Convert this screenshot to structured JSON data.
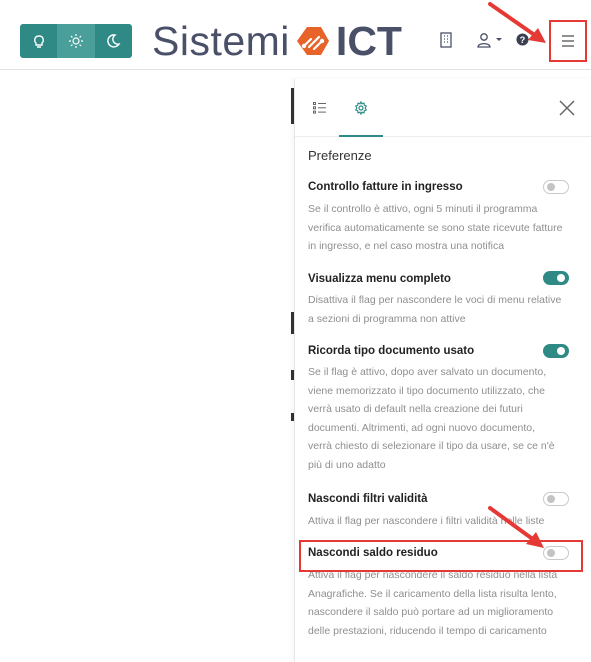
{
  "theme": {
    "options": [
      {
        "name": "light",
        "icon": "lightbulb-icon"
      },
      {
        "name": "auto",
        "icon": "sun-icon"
      },
      {
        "name": "dark",
        "icon": "moon-icon"
      }
    ],
    "active": "auto",
    "accent": "#2f8a86"
  },
  "logo": {
    "part1": "Sistemi",
    "part2": "ICT",
    "mark_color": "#e8632a"
  },
  "toolbar": {
    "icons": [
      "building-icon",
      "user-icon",
      "help-icon",
      "hamburger-menu-icon"
    ]
  },
  "panel": {
    "tabs": [
      {
        "name": "list",
        "icon": "list-icon"
      },
      {
        "name": "settings",
        "icon": "gear-icon"
      }
    ],
    "active_tab": "settings",
    "section_title": "Preferenze",
    "preferences": [
      {
        "title": "Controllo fatture in ingresso",
        "enabled": false,
        "lines": [
          "Se il controllo è attivo, ogni 5 minuti il programma",
          "verifica automaticamente se sono state ricevute fatture",
          "in ingresso, e nel caso mostra una notifica"
        ]
      },
      {
        "title": "Visualizza menu completo",
        "enabled": true,
        "lines": [
          "Disattiva il flag per nascondere le voci di menu relative",
          "a sezioni di programma non attive"
        ]
      },
      {
        "title": "Ricorda tipo documento usato",
        "enabled": true,
        "lines": [
          "Se il flag è attivo, dopo aver salvato un documento,",
          "viene memorizzato il tipo documento utilizzato, che",
          "verrà usato di default nella creazione dei futuri",
          "documenti. Altrimenti, ad ogni nuovo documento,",
          "verrà chiesto di selezionare il tipo da usare, se ce n'è",
          "più di uno adatto"
        ]
      },
      {
        "title": "Nascondi filtri validità",
        "enabled": false,
        "lines": [
          "Attiva il flag per nascondere i filtri validità nelle liste"
        ]
      },
      {
        "title": "Nascondi saldo residuo",
        "enabled": false,
        "lines": [
          "Attiva il flag per nascondere il saldo residuo nella lista",
          "Anagrafiche. Se il caricamento della lista risulta lento,",
          "nascondere il saldo può portare ad un miglioramento",
          "delle prestazioni, riducendo il tempo di caricamento"
        ]
      }
    ]
  },
  "annotations": {
    "highlight_color": "#e53935"
  }
}
